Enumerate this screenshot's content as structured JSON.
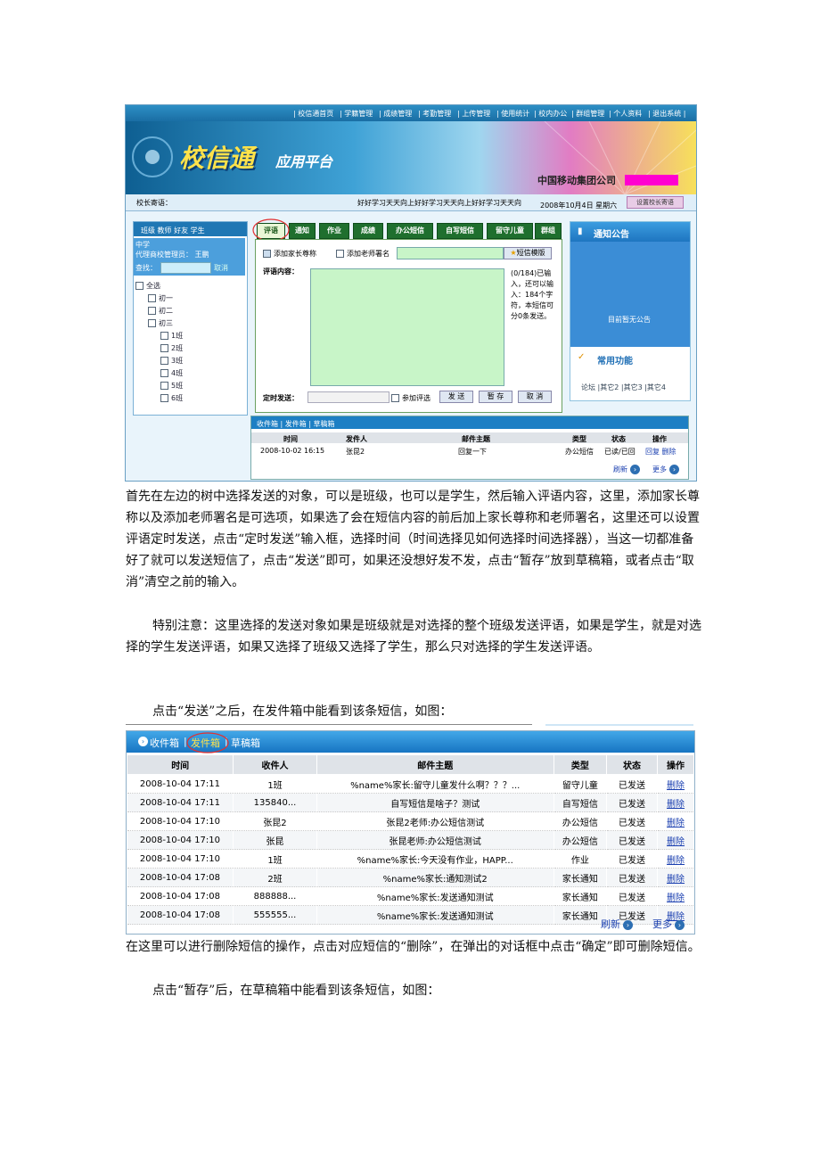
{
  "screenshot1": {
    "top_nav": [
      "| 校信通首页",
      "| 学籍管理",
      "| 成绩管理",
      "| 考勤管理",
      "| 上传管理",
      "| 使用统计",
      "| 校内办公",
      "| 群组管理",
      "| 个人资料",
      "| 退出系统 |"
    ],
    "banner_logo": "校信通",
    "banner_sub": "应用平台",
    "corp_name": "中国移动集团公司",
    "msg_label": "校长寄语：",
    "msg_text": "好好学习天天向上好好学习天天向上好好学习天天向",
    "date": "2008年10月4日 星期六",
    "msg_button": "设置校长寄语",
    "left_tabs": "班级  教师  好友  学生",
    "school": "中学",
    "admin": "代理商校管理员： 王鹏",
    "search_label": "查找：",
    "search_cancel": "取消",
    "tree": {
      "all": "全选",
      "g1": "初一",
      "g2": "初二",
      "g3": "初三",
      "classes": [
        "1班",
        "2班",
        "3班",
        "4班",
        "5班",
        "6班"
      ]
    },
    "tabs": [
      "评语",
      "通知",
      "作业",
      "成绩",
      "办公短信",
      "自写短信",
      "留守儿童",
      "群组"
    ],
    "opt_parent": "添加家长尊称",
    "opt_teacher": "添加老师署名",
    "template_btn": "短信模版",
    "content_label": "评语内容：",
    "counter": "(0/184)已输入，还可以输入：184个字符，本短信可分0条发送。",
    "schedule_label": "定时发送：",
    "join_review": "参加评选",
    "btn_send": "发 送",
    "btn_save": "暂 存",
    "btn_cancel": "取 消",
    "notice_title": "通知公告",
    "notice_empty": "目前暂无公告",
    "func_title": "常用功能",
    "func_links": "论坛 |其它2 |其它3 |其它4",
    "mail_tabs": "收件箱 | 发件箱 | 草稿箱",
    "mail_headers": [
      "时间",
      "发件人",
      "邮件主题",
      "类型",
      "状态",
      "操作"
    ],
    "mail_row": [
      "2008-10-02 16:15",
      "张昆2",
      "回复一下",
      "办公短信",
      "已读/已回",
      "回复 删除"
    ],
    "refresh": "刷新",
    "more": "更多"
  },
  "paragraphs": {
    "p1": "首先在左边的树中选择发送的对象，可以是班级，也可以是学生，然后输入评语内容，这里，添加家长尊称以及添加老师署名是可选项，如果选了会在短信内容的前后加上家长尊称和老师署名，这里还可以设置评语定时发送，点击“定时发送”输入框，选择时间（时间选择见如何选择时间选择器），当这一切都准备好了就可以发送短信了，点击“发送”即可，如果还没想好发不发，点击“暂存”放到草稿箱，或者点击“取消”清空之前的输入。",
    "p2": "特别注意：这里选择的发送对象如果是班级就是对选择的整个班级发送评语，如果是学生，就是对选择的学生发送评语，如果又选择了班级又选择了学生，那么只对选择的学生发送评语。",
    "p3": "点击“发送”之后，在发件箱中能看到该条短信，如图：",
    "p4": "在这里可以进行删除短信的操作，点击对应短信的“删除”，在弹出的对话框中点击“确定”即可删除短信。",
    "p5": "点击“暂存”后，在草稿箱中能看到该条短信，如图："
  },
  "outbox": {
    "tab_inbox": "收件箱",
    "tab_outbox": "发件箱",
    "tab_draft": "草稿箱",
    "headers": [
      "时间",
      "收件人",
      "邮件主题",
      "类型",
      "状态",
      "操作"
    ],
    "rows": [
      [
        "2008-10-04 17:11",
        "1班",
        "%name%家长:留守儿童发什么啊？？？...",
        "留守儿童",
        "已发送",
        "删除"
      ],
      [
        "2008-10-04 17:11",
        "135840...",
        "自写短信是啥子？测试",
        "自写短信",
        "已发送",
        "删除"
      ],
      [
        "2008-10-04 17:10",
        "张昆2",
        "张昆2老师:办公短信测试",
        "办公短信",
        "已发送",
        "删除"
      ],
      [
        "2008-10-04 17:10",
        "张昆",
        "张昆老师:办公短信测试",
        "办公短信",
        "已发送",
        "删除"
      ],
      [
        "2008-10-04 17:10",
        "1班",
        "%name%家长:今天没有作业，HAPP...",
        "作业",
        "已发送",
        "删除"
      ],
      [
        "2008-10-04 17:08",
        "2班",
        "%name%家长:通知测试2",
        "家长通知",
        "已发送",
        "删除"
      ],
      [
        "2008-10-04 17:08",
        "888888...",
        "%name%家长:发送通知测试",
        "家长通知",
        "已发送",
        "删除"
      ],
      [
        "2008-10-04 17:08",
        "555555...",
        "%name%家长:发送通知测试",
        "家长通知",
        "已发送",
        "删除"
      ]
    ],
    "refresh": "刷新",
    "more": "更多"
  }
}
